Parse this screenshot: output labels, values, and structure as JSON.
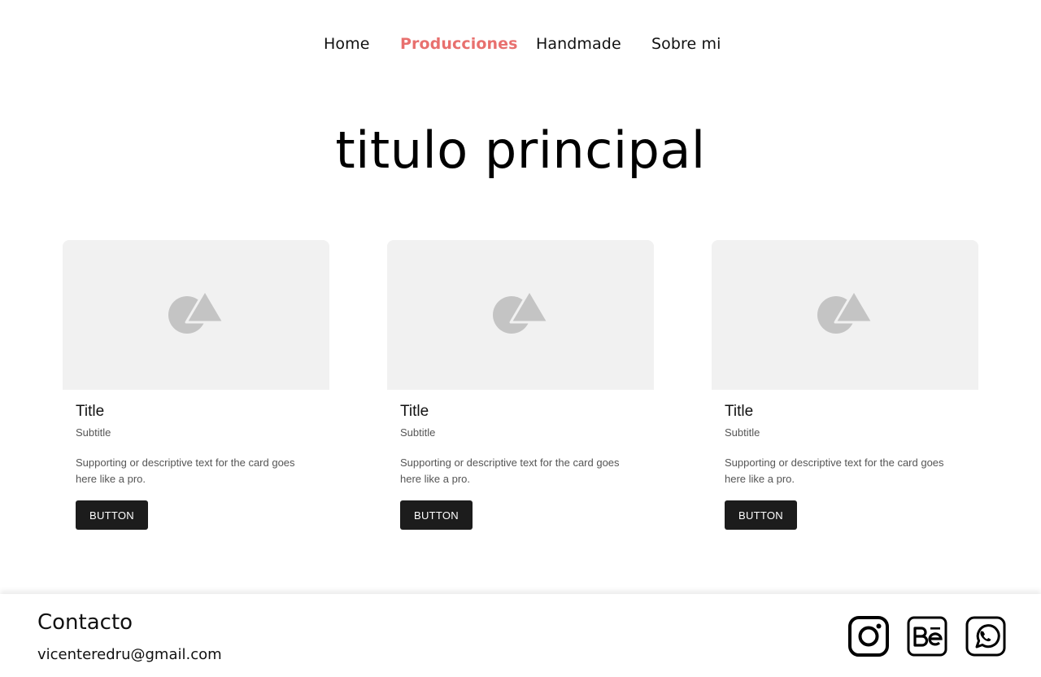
{
  "nav": {
    "items": [
      {
        "label": "Home",
        "active": false
      },
      {
        "label": "Producciones",
        "active": true
      },
      {
        "label": "Handmade",
        "active": false
      },
      {
        "label": "Sobre mi",
        "active": false
      }
    ],
    "active_color": "#e8706e"
  },
  "main": {
    "title": "titulo principal"
  },
  "cards": [
    {
      "media_icon": "image-placeholder-icon",
      "title": "Title",
      "subtitle": "Subtitle",
      "text": "Supporting or descriptive text for the card goes here like a pro.",
      "button_label": "BUTTON"
    },
    {
      "media_icon": "image-placeholder-icon",
      "title": "Title",
      "subtitle": "Subtitle",
      "text": "Supporting or descriptive text for the card goes here like a pro.",
      "button_label": "BUTTON"
    },
    {
      "media_icon": "image-placeholder-icon",
      "title": "Title",
      "subtitle": "Subtitle",
      "text": "Supporting or descriptive text for the card goes here like a pro.",
      "button_label": "BUTTON"
    }
  ],
  "footer": {
    "heading": "Contacto",
    "email": "vicenteredru@gmail.com",
    "social": [
      {
        "icon": "instagram-icon"
      },
      {
        "icon": "behance-icon"
      },
      {
        "icon": "whatsapp-icon"
      }
    ]
  }
}
